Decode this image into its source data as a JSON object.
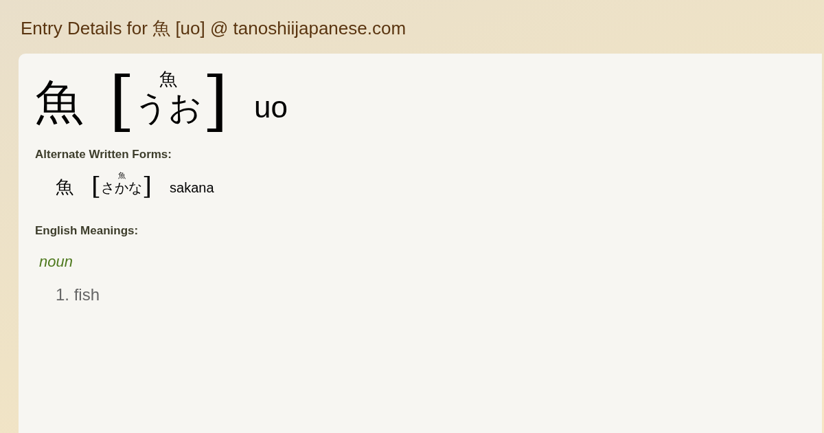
{
  "title": "Entry Details for 魚 [uo] @ tanoshiijapanese.com",
  "entry": {
    "written": "魚",
    "open_bracket": "[",
    "furigana": "魚",
    "reading": "うお",
    "close_bracket": "]",
    "romaji": "uo"
  },
  "alternate": {
    "heading": "Alternate Written Forms:",
    "forms": [
      {
        "written": "魚",
        "open_bracket": "[",
        "furigana": "魚",
        "reading": "さかな",
        "close_bracket": "]",
        "romaji": "sakana"
      }
    ]
  },
  "meanings": {
    "heading": "English Meanings:",
    "groups": [
      {
        "pos": "noun",
        "senses": [
          "1. fish"
        ]
      }
    ]
  }
}
